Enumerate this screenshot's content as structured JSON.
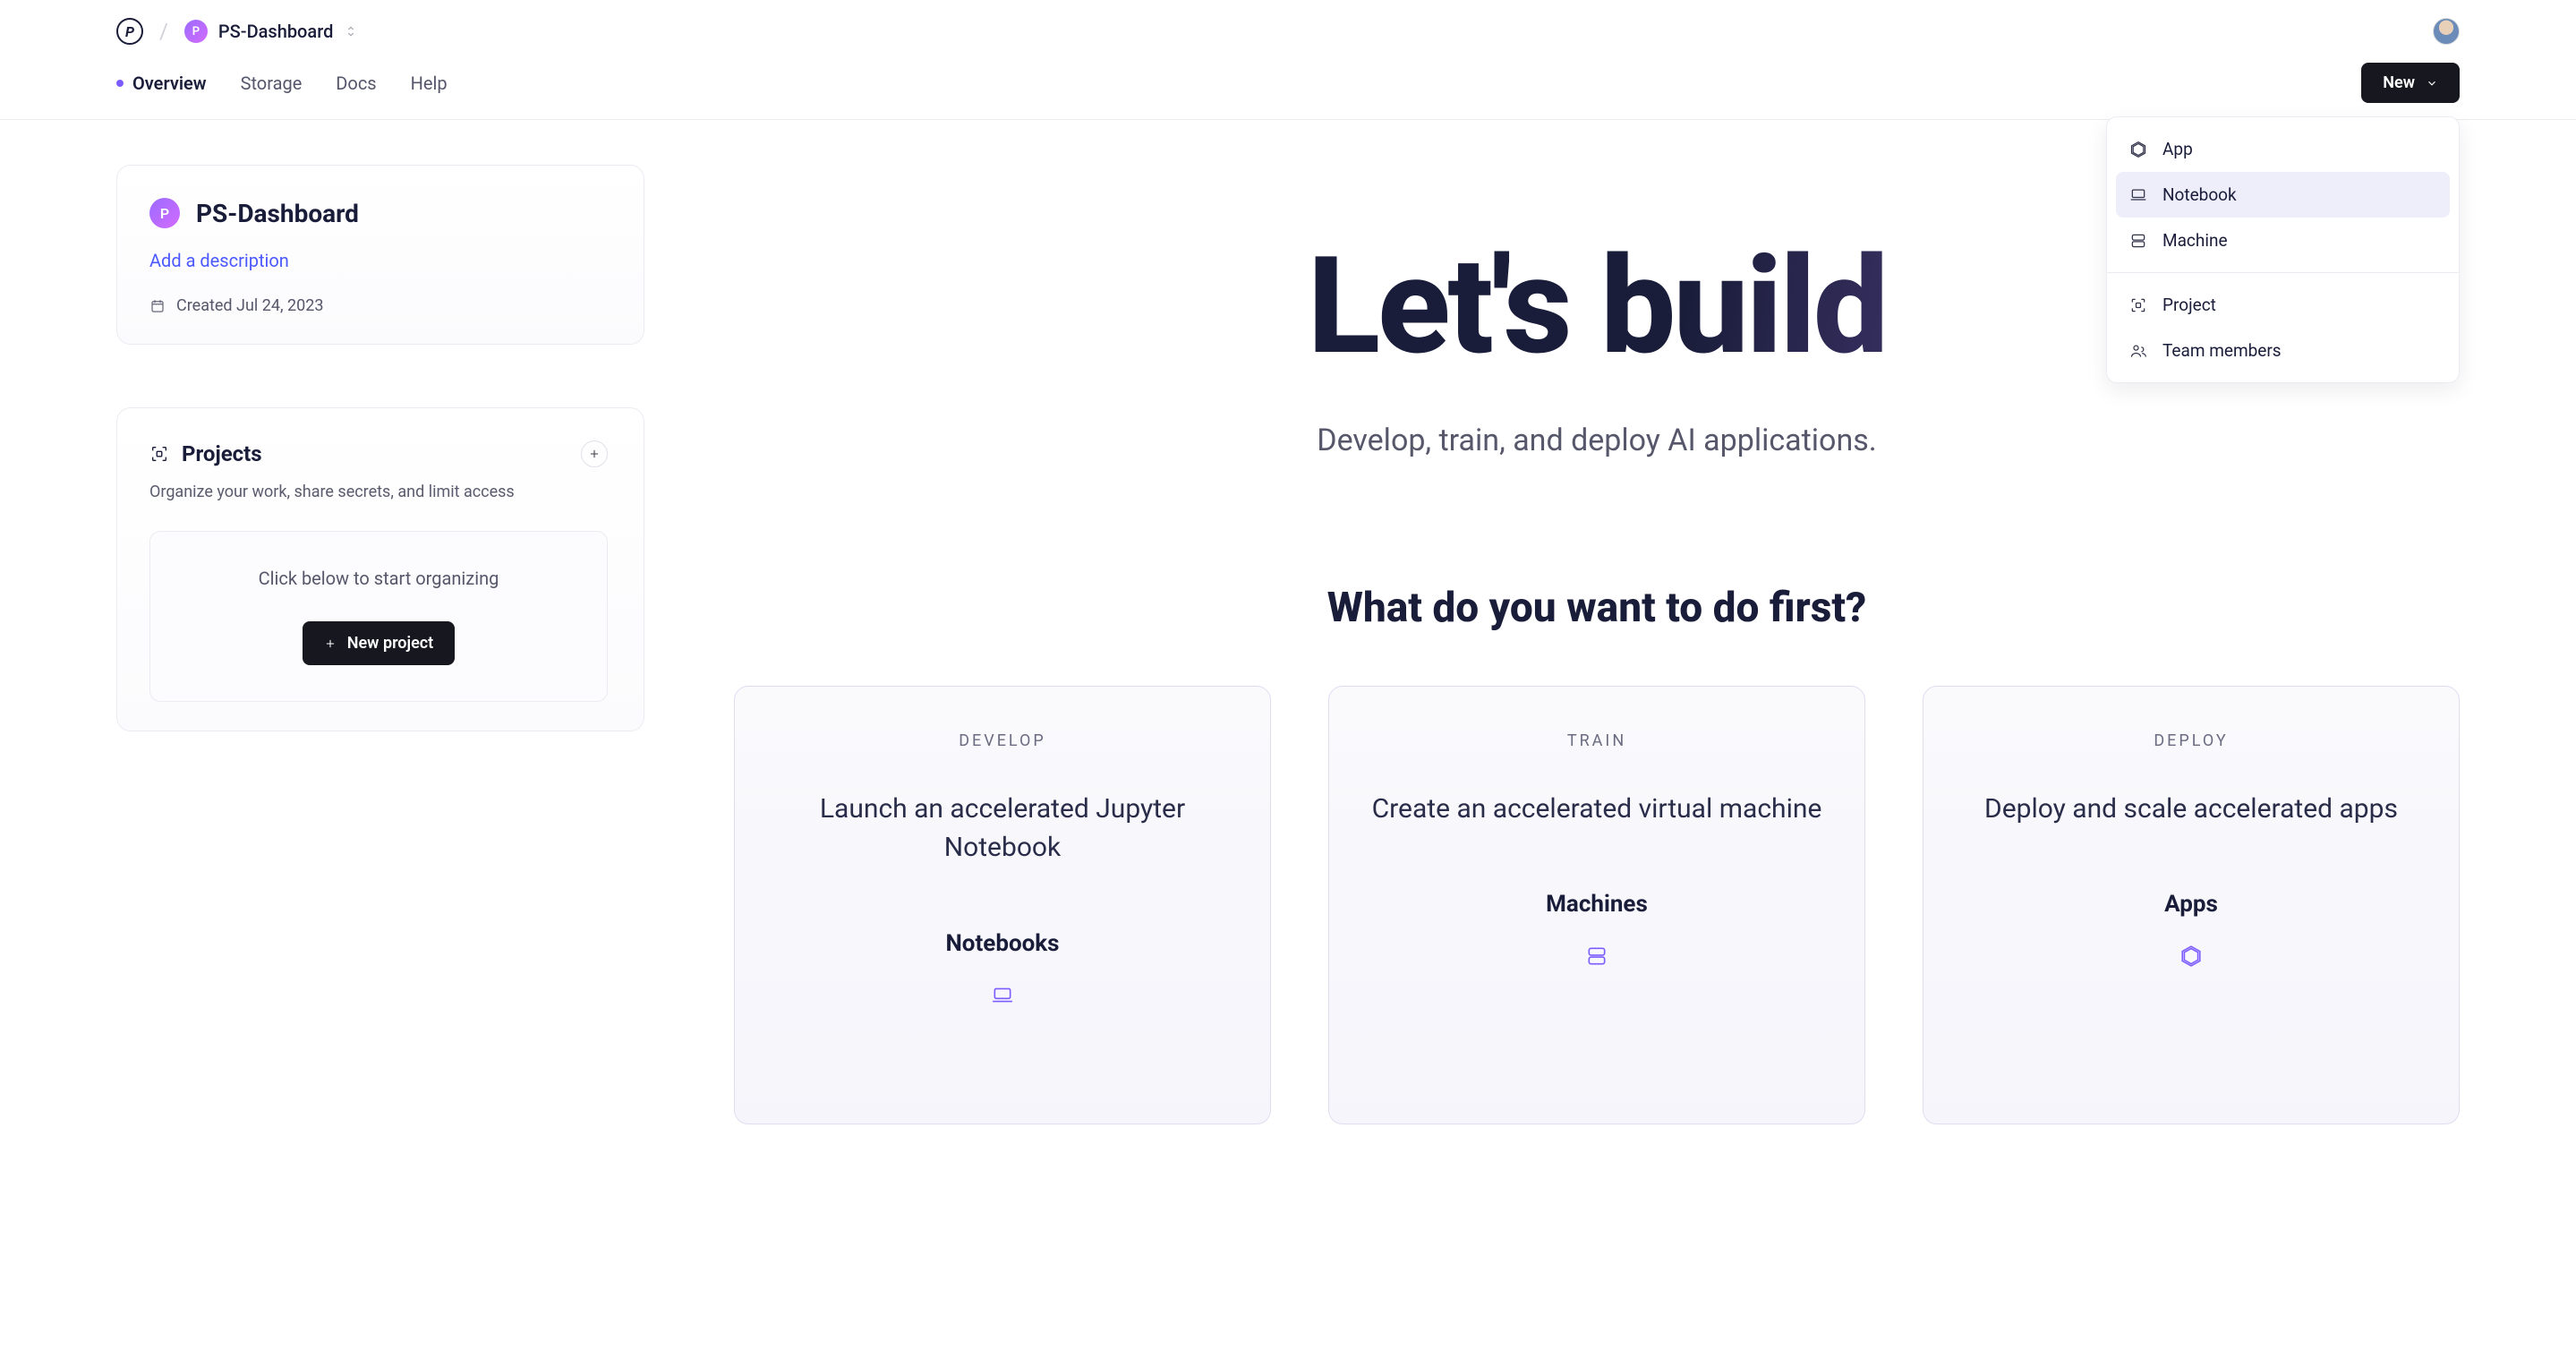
{
  "header": {
    "logo_letter": "P",
    "workspace_badge": "P",
    "workspace_name": "PS-Dashboard"
  },
  "nav": {
    "tabs": [
      "Overview",
      "Storage",
      "Docs",
      "Help"
    ],
    "active_index": 0,
    "new_button": "New"
  },
  "dropdown": {
    "items": [
      {
        "icon": "cube-icon",
        "label": "App"
      },
      {
        "icon": "laptop-icon",
        "label": "Notebook"
      },
      {
        "icon": "server-icon",
        "label": "Machine"
      }
    ],
    "items2": [
      {
        "icon": "focus-icon",
        "label": "Project"
      },
      {
        "icon": "team-icon",
        "label": "Team members"
      }
    ],
    "selected_index": 1
  },
  "sidebar": {
    "project_card": {
      "badge": "P",
      "title": "PS-Dashboard",
      "add_description": "Add a description",
      "created": "Created Jul 24, 2023"
    },
    "projects_panel": {
      "title": "Projects",
      "subtitle": "Organize your work, share secrets, and limit access",
      "empty_text": "Click below to start organizing",
      "new_project_button": "New project"
    }
  },
  "hero": {
    "title": "Let's build",
    "subtitle": "Develop, train, and deploy AI applications.",
    "prompt": "What do you want to do first?"
  },
  "options": [
    {
      "tag": "DEVELOP",
      "desc": "Launch an accelerated Jupyter Notebook",
      "name": "Notebooks",
      "icon": "laptop-icon"
    },
    {
      "tag": "TRAIN",
      "desc": "Create an accelerated virtual machine",
      "name": "Machines",
      "icon": "server-icon"
    },
    {
      "tag": "DEPLOY",
      "desc": "Deploy and scale accelerated apps",
      "name": "Apps",
      "icon": "cube-icon"
    }
  ]
}
